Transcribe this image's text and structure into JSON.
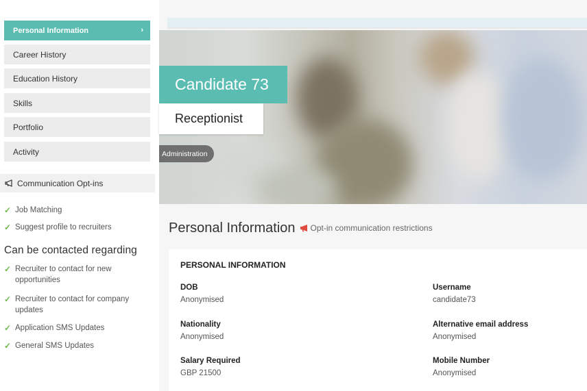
{
  "sidebar": {
    "items": [
      {
        "label": "Personal Information",
        "active": true
      },
      {
        "label": "Career History"
      },
      {
        "label": "Education History"
      },
      {
        "label": "Skills"
      },
      {
        "label": "Portfolio"
      },
      {
        "label": "Activity"
      }
    ],
    "optins_title": "Communication Opt-ins",
    "optins": [
      "Job Matching",
      "Suggest profile to recruiters"
    ],
    "contact_heading": "Can be contacted regarding",
    "contact_items": [
      "Recruiter to contact for new opportunities",
      "Recruiter to contact for company updates",
      "Application SMS Updates",
      "General SMS Updates"
    ]
  },
  "profile": {
    "name": "Candidate 73",
    "role": "Receptionist",
    "tag": "Administration"
  },
  "main": {
    "section_title": "Personal Information",
    "restriction_link": "Opt-in communication restrictions",
    "card": {
      "title": "PERSONAL INFORMATION",
      "fields": [
        {
          "label": "DOB",
          "value": "Anonymised"
        },
        {
          "label": "Username",
          "value": "candidate73"
        },
        {
          "label": "Nationality",
          "value": "Anonymised"
        },
        {
          "label": "Alternative email address",
          "value": "Anonymised"
        },
        {
          "label": "Salary Required",
          "value": "GBP 21500"
        },
        {
          "label": "Mobile Number",
          "value": "Anonymised"
        }
      ]
    }
  },
  "colors": {
    "accent": "#5bbcb1",
    "check": "#6cb94a",
    "megaphone_red": "#e04a3f"
  },
  "icons": {
    "nav_chevron": "chevron-right-icon",
    "optins": "megaphone-icon",
    "check": "check-icon"
  }
}
